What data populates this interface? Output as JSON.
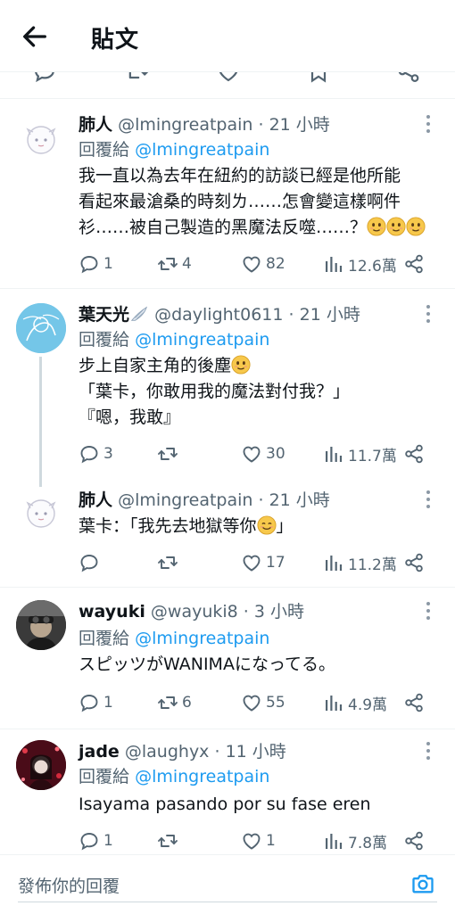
{
  "header": {
    "title": "貼文"
  },
  "tweets": [
    {
      "name": "肺人",
      "handle": "@lmingreatpain",
      "time": "21 小時",
      "reply_prefix": "回覆給",
      "reply_to": "@lmingreatpain",
      "lines": [
        "我一直以為去年在紐約的訪談已經是他所能",
        "看起來最滄桑的時刻ㄌ……怎會變這樣啊件",
        "衫……被自己製造的黑魔法反噬……？"
      ],
      "replies": "1",
      "retweets": "4",
      "likes": "82",
      "views": "12.6萬"
    },
    {
      "name": "葉天光",
      "handle": "@daylight0611",
      "time": "21 小時",
      "reply_prefix": "回覆給",
      "reply_to": "@lmingreatpain",
      "lines": [
        "步上自家主角的後塵",
        "「葉卡，你敢用我的魔法對付我？」",
        "『嗯，我敢』"
      ],
      "replies": "3",
      "retweets": "",
      "likes": "30",
      "views": "11.7萬"
    },
    {
      "name": "肺人",
      "handle": "@lmingreatpain",
      "time": "21 小時",
      "lines": [
        "葉卡：「我先去地獄等你",
        "」"
      ],
      "replies": "",
      "retweets": "",
      "likes": "17",
      "views": "11.2萬"
    },
    {
      "name": "wayuki",
      "handle": "@wayuki8",
      "time": "3 小時",
      "reply_prefix": "回覆給",
      "reply_to": "@lmingreatpain",
      "lines": [
        "スピッツがWANIMAになってる。"
      ],
      "replies": "1",
      "retweets": "6",
      "likes": "55",
      "views": "4.9萬"
    },
    {
      "name": "jade",
      "handle": "@laughyx",
      "time": "11 小時",
      "reply_prefix": "回覆給",
      "reply_to": "@lmingreatpain",
      "lines": [
        "Isayama pasando por su fase eren"
      ],
      "replies": "1",
      "retweets": "",
      "likes": "1",
      "views": "7.8萬"
    }
  ],
  "composer": {
    "placeholder": "發佈你的回覆"
  },
  "colors": {
    "accent": "#1d9bf0",
    "text": "#0f1419",
    "secondary": "#536471",
    "divider": "#eff3f4"
  },
  "icons": [
    "back-arrow-icon",
    "reply-icon",
    "retweet-icon",
    "like-icon",
    "views-icon",
    "share-icon",
    "more-icon",
    "camera-icon",
    "bookmark-icon",
    "emoji-icon",
    "wing-emoji-icon"
  ]
}
